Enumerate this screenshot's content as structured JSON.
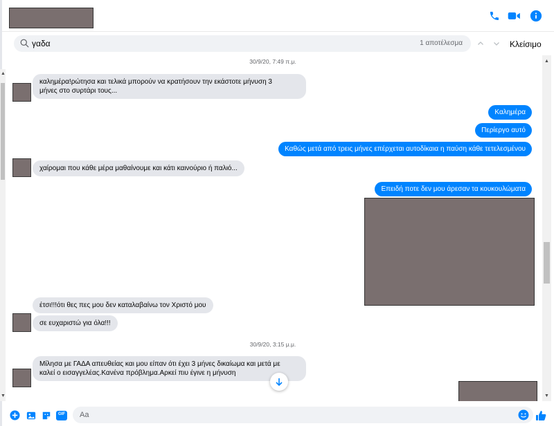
{
  "colors": {
    "accent": "#0084ff",
    "incoming_bubble": "#e4e6eb",
    "redaction": "#7a6f6f"
  },
  "header": {
    "icons": [
      "phone-icon",
      "video-call-icon",
      "info-icon"
    ]
  },
  "search": {
    "value": "γαδα",
    "result_count": "1 αποτέλεσμα",
    "close_label": "Κλείσιμο",
    "icons": [
      "search-icon",
      "chevron-up-icon",
      "chevron-down-icon"
    ]
  },
  "chat": {
    "timestamps": [
      "30/9/20, 7:49 π.μ.",
      "30/9/20, 3:15 μ.μ."
    ],
    "messages": [
      {
        "direction": "in",
        "text_lines": [
          "καλημέρα!ρώτησα και τελικά μπορούν να κρατήσουν την εκάστοτε μήνυση 3",
          "μήνες στο συρτάρι τους..."
        ]
      },
      {
        "direction": "out",
        "text": "Καλημέρα"
      },
      {
        "direction": "out",
        "text": "Περίεργο αυτό"
      },
      {
        "direction": "out",
        "text": "Καθώς μετά από τρεις μήνες επέρχεται αυτοδίκαια η παύση κάθε τετελεσμένου"
      },
      {
        "direction": "in",
        "text": "χαίρομαι που κάθε μέρα μαθαίνουμε και κάτι καινούριο ή παλιό..."
      },
      {
        "direction": "out",
        "text": "Επειδή ποτε δεν μου άρεσαν τα κουκουλώματα"
      },
      {
        "direction": "in",
        "text": "έτσι!!!ότι θες πες μου δεν καταλαβαίνω τον Χριστό μου"
      },
      {
        "direction": "in",
        "text": "σε ευχαριστώ για όλα!!!"
      },
      {
        "direction": "in",
        "text_lines": [
          "Μίλησα με ΓΑΔΑ απευθείας και μου είπαν ότι έχει 3 μήνες δικαίωμα και μετά με",
          "καλεί ο εισαγγελέας.Κανένα πρόβλημα.Αρκεί πιυ έγινε η μήνυση"
        ]
      }
    ]
  },
  "composer": {
    "placeholder": "Aa",
    "icons": [
      "add-icon",
      "photo-icon",
      "sticker-icon",
      "gif-icon",
      "emoji-icon",
      "like-icon"
    ],
    "gif_label": "GIF"
  }
}
